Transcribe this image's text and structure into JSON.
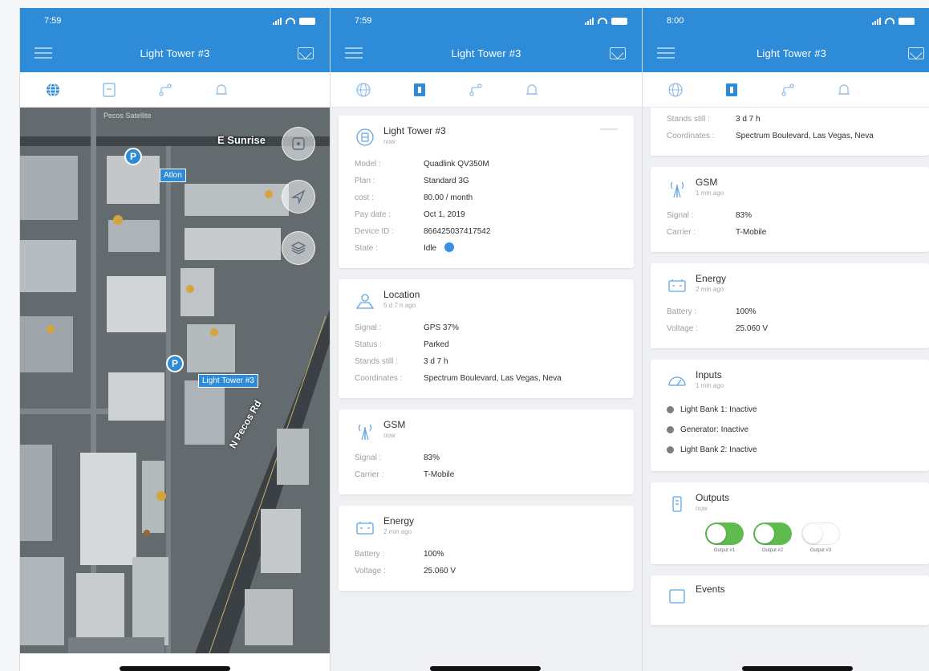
{
  "screens": [
    {
      "time": "7:59",
      "title": "Light Tower #3",
      "map": {
        "street_top": "E Sunrise",
        "street_diag": "N Pecos Rd",
        "attribution": "Pecos Satellite",
        "pins": [
          {
            "letter": "P",
            "label": "Atlon"
          },
          {
            "letter": "P",
            "label": "Light Tower #3"
          }
        ]
      }
    },
    {
      "time": "7:59",
      "title": "Light Tower #3",
      "cards": {
        "device": {
          "title": "Light Tower #3",
          "sub": "now",
          "rows": [
            {
              "k": "Model :",
              "v": "Quadlink QV350M"
            },
            {
              "k": "Plan :",
              "v": "Standard 3G"
            },
            {
              "k": "cost :",
              "v": "80.00 / month"
            },
            {
              "k": "Pay date :",
              "v": "Oct 1, 2019"
            },
            {
              "k": "Device ID :",
              "v": "866425037417542"
            },
            {
              "k": "State :",
              "v": "Idle"
            }
          ]
        },
        "location": {
          "title": "Location",
          "sub": "5 d 7 h ago",
          "rows": [
            {
              "k": "Signal :",
              "v": "GPS 37%"
            },
            {
              "k": "Status :",
              "v": "Parked"
            },
            {
              "k": "Stands still :",
              "v": "3 d 7 h"
            },
            {
              "k": "Coordinates :",
              "v": "Spectrum Boulevard, Las Vegas, Neva"
            }
          ]
        },
        "gsm": {
          "title": "GSM",
          "sub": "now",
          "rows": [
            {
              "k": "Signal :",
              "v": "83%"
            },
            {
              "k": "Carrier :",
              "v": "T-Mobile"
            }
          ]
        },
        "energy": {
          "title": "Energy",
          "sub": "2 min ago",
          "rows": [
            {
              "k": "Battery :",
              "v": "100%"
            },
            {
              "k": "Voltage :",
              "v": "25.060 V"
            }
          ]
        }
      }
    },
    {
      "time": "8:00",
      "title": "Light Tower #3",
      "location_tail": [
        {
          "k": "Stands still :",
          "v": "3 d 7 h"
        },
        {
          "k": "Coordinates :",
          "v": "Spectrum Boulevard, Las Vegas, Neva"
        }
      ],
      "cards": {
        "gsm": {
          "title": "GSM",
          "sub": "1 min ago",
          "rows": [
            {
              "k": "Signal :",
              "v": "83%"
            },
            {
              "k": "Carrier :",
              "v": "T-Mobile"
            }
          ]
        },
        "energy": {
          "title": "Energy",
          "sub": "2 min ago",
          "rows": [
            {
              "k": "Battery :",
              "v": "100%"
            },
            {
              "k": "Voltage :",
              "v": "25.060 V"
            }
          ]
        },
        "inputs": {
          "title": "Inputs",
          "sub": "1 min ago",
          "items": [
            "Light Bank 1: Inactive",
            "Generator: Inactive",
            "Light Bank 2: Inactive"
          ]
        },
        "outputs": {
          "title": "Outputs",
          "sub": "now",
          "toggles": [
            {
              "label": "Output #1",
              "on": true
            },
            {
              "label": "Output #2",
              "on": true
            },
            {
              "label": "Output #3",
              "on": false
            }
          ]
        },
        "next_title": "Events"
      }
    }
  ],
  "colors": {
    "primary": "#2d8bd8",
    "toggle_on": "#5fbb4e",
    "state_dot": "#3b8ee6"
  },
  "icons": [
    "menu-icon",
    "mail-icon",
    "globe-icon",
    "info-icon",
    "route-icon",
    "bell-icon",
    "crosshair-icon",
    "navigation-icon",
    "layers-icon",
    "tower-icon",
    "location-icon",
    "antenna-icon",
    "battery-icon",
    "gauge-icon",
    "output-icon"
  ]
}
